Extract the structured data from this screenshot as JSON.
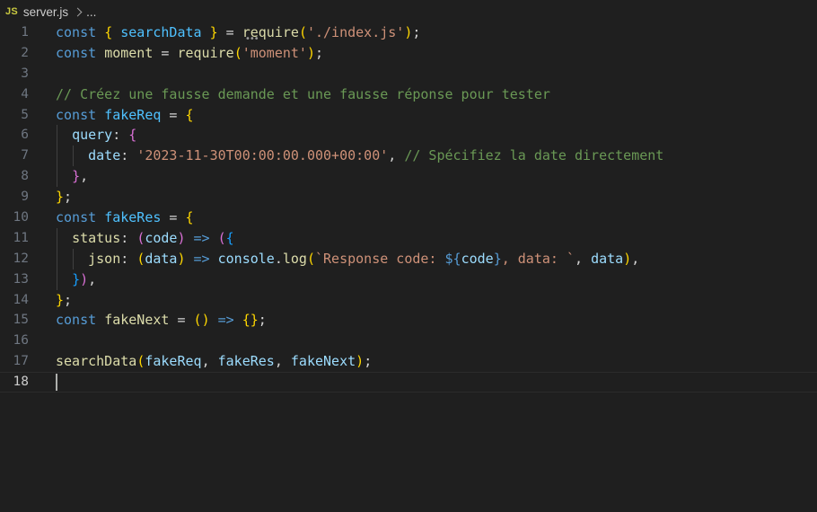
{
  "breadcrumb": {
    "file_icon": "JS",
    "file_name": "server.js",
    "separator_icon": "chevron-right-icon",
    "more": "..."
  },
  "colors": {
    "background": "#1f1f1f",
    "keyword": "#569cd6",
    "variable": "#9cdcfe",
    "constant": "#4fc1ff",
    "function": "#dcdcaa",
    "string": "#ce9178",
    "comment": "#6a9955",
    "punctuation": "#d4d4d4",
    "bracket_level1": "#ffd700",
    "bracket_level2": "#da70d6",
    "bracket_level3": "#179fff"
  },
  "editor": {
    "active_line": 18,
    "lines": [
      {
        "n": "1",
        "tokens": [
          {
            "t": "const",
            "c": "kw"
          },
          {
            "t": " ",
            "c": "p"
          },
          {
            "t": "{",
            "c": "b1"
          },
          {
            "t": " ",
            "c": "p"
          },
          {
            "t": "searchData",
            "c": "const"
          },
          {
            "t": " ",
            "c": "p"
          },
          {
            "t": "}",
            "c": "b1"
          },
          {
            "t": " = ",
            "c": "p"
          },
          {
            "t": "require",
            "c": "fn"
          },
          {
            "t": "(",
            "c": "b1"
          },
          {
            "t": "'./index.js'",
            "c": "str"
          },
          {
            "t": ")",
            "c": "b1"
          },
          {
            "t": ";",
            "c": "p"
          }
        ]
      },
      {
        "n": "2",
        "tokens": [
          {
            "t": "const",
            "c": "kw"
          },
          {
            "t": " ",
            "c": "p"
          },
          {
            "t": "moment",
            "c": "fn"
          },
          {
            "t": " = ",
            "c": "p"
          },
          {
            "t": "require",
            "c": "fn"
          },
          {
            "t": "(",
            "c": "b1"
          },
          {
            "t": "'moment'",
            "c": "str"
          },
          {
            "t": ")",
            "c": "b1"
          },
          {
            "t": ";",
            "c": "p"
          }
        ]
      },
      {
        "n": "3",
        "tokens": []
      },
      {
        "n": "4",
        "tokens": [
          {
            "t": "// Créez une fausse demande et une fausse réponse pour tester",
            "c": "cm"
          }
        ]
      },
      {
        "n": "5",
        "tokens": [
          {
            "t": "const",
            "c": "kw"
          },
          {
            "t": " ",
            "c": "p"
          },
          {
            "t": "fakeReq",
            "c": "const"
          },
          {
            "t": " = ",
            "c": "p"
          },
          {
            "t": "{",
            "c": "b1"
          }
        ]
      },
      {
        "n": "6",
        "guides": [
          1
        ],
        "tokens": [
          {
            "t": "  ",
            "c": "p"
          },
          {
            "t": "query",
            "c": "var"
          },
          {
            "t": ": ",
            "c": "p"
          },
          {
            "t": "{",
            "c": "b2"
          }
        ]
      },
      {
        "n": "7",
        "guides": [
          1,
          2
        ],
        "tokens": [
          {
            "t": "    ",
            "c": "p"
          },
          {
            "t": "date",
            "c": "var"
          },
          {
            "t": ": ",
            "c": "p"
          },
          {
            "t": "'2023-11-30T00:00:00.000+00:00'",
            "c": "str"
          },
          {
            "t": ", ",
            "c": "p"
          },
          {
            "t": "// Spécifiez la date directement",
            "c": "cm"
          }
        ]
      },
      {
        "n": "8",
        "guides": [
          1
        ],
        "tokens": [
          {
            "t": "  ",
            "c": "p"
          },
          {
            "t": "}",
            "c": "b2"
          },
          {
            "t": ",",
            "c": "p"
          }
        ]
      },
      {
        "n": "9",
        "tokens": [
          {
            "t": "}",
            "c": "b1"
          },
          {
            "t": ";",
            "c": "p"
          }
        ]
      },
      {
        "n": "10",
        "tokens": [
          {
            "t": "const",
            "c": "kw"
          },
          {
            "t": " ",
            "c": "p"
          },
          {
            "t": "fakeRes",
            "c": "const"
          },
          {
            "t": " = ",
            "c": "p"
          },
          {
            "t": "{",
            "c": "b1"
          }
        ]
      },
      {
        "n": "11",
        "guides": [
          1
        ],
        "tokens": [
          {
            "t": "  ",
            "c": "p"
          },
          {
            "t": "status",
            "c": "fn"
          },
          {
            "t": ": ",
            "c": "p"
          },
          {
            "t": "(",
            "c": "b2"
          },
          {
            "t": "code",
            "c": "var"
          },
          {
            "t": ")",
            "c": "b2"
          },
          {
            "t": " ",
            "c": "p"
          },
          {
            "t": "=>",
            "c": "kw"
          },
          {
            "t": " ",
            "c": "p"
          },
          {
            "t": "(",
            "c": "b2"
          },
          {
            "t": "{",
            "c": "b3"
          }
        ]
      },
      {
        "n": "12",
        "guides": [
          1,
          2
        ],
        "tokens": [
          {
            "t": "    ",
            "c": "p"
          },
          {
            "t": "json",
            "c": "fn"
          },
          {
            "t": ": ",
            "c": "p"
          },
          {
            "t": "(",
            "c": "b1"
          },
          {
            "t": "data",
            "c": "var"
          },
          {
            "t": ")",
            "c": "b1"
          },
          {
            "t": " ",
            "c": "p"
          },
          {
            "t": "=>",
            "c": "kw"
          },
          {
            "t": " ",
            "c": "p"
          },
          {
            "t": "console",
            "c": "var"
          },
          {
            "t": ".",
            "c": "p"
          },
          {
            "t": "log",
            "c": "fn"
          },
          {
            "t": "(",
            "c": "b1"
          },
          {
            "t": "`Response code: ",
            "c": "str"
          },
          {
            "t": "${",
            "c": "kw"
          },
          {
            "t": "code",
            "c": "var"
          },
          {
            "t": "}",
            "c": "kw"
          },
          {
            "t": ", data: `",
            "c": "str"
          },
          {
            "t": ", ",
            "c": "p"
          },
          {
            "t": "data",
            "c": "var"
          },
          {
            "t": ")",
            "c": "b1"
          },
          {
            "t": ",",
            "c": "p"
          }
        ]
      },
      {
        "n": "13",
        "guides": [
          1
        ],
        "tokens": [
          {
            "t": "  ",
            "c": "p"
          },
          {
            "t": "}",
            "c": "b3"
          },
          {
            "t": ")",
            "c": "b2"
          },
          {
            "t": ",",
            "c": "p"
          }
        ]
      },
      {
        "n": "14",
        "tokens": [
          {
            "t": "}",
            "c": "b1"
          },
          {
            "t": ";",
            "c": "p"
          }
        ]
      },
      {
        "n": "15",
        "tokens": [
          {
            "t": "const",
            "c": "kw"
          },
          {
            "t": " ",
            "c": "p"
          },
          {
            "t": "fakeNext",
            "c": "fn"
          },
          {
            "t": " = ",
            "c": "p"
          },
          {
            "t": "(",
            "c": "b1"
          },
          {
            "t": ")",
            "c": "b1"
          },
          {
            "t": " ",
            "c": "p"
          },
          {
            "t": "=>",
            "c": "kw"
          },
          {
            "t": " ",
            "c": "p"
          },
          {
            "t": "{",
            "c": "b1"
          },
          {
            "t": "}",
            "c": "b1"
          },
          {
            "t": ";",
            "c": "p"
          }
        ]
      },
      {
        "n": "16",
        "tokens": []
      },
      {
        "n": "17",
        "tokens": [
          {
            "t": "searchData",
            "c": "fn"
          },
          {
            "t": "(",
            "c": "b1"
          },
          {
            "t": "fakeReq",
            "c": "var"
          },
          {
            "t": ", ",
            "c": "p"
          },
          {
            "t": "fakeRes",
            "c": "var"
          },
          {
            "t": ", ",
            "c": "p"
          },
          {
            "t": "fakeNext",
            "c": "var"
          },
          {
            "t": ")",
            "c": "b1"
          },
          {
            "t": ";",
            "c": "p"
          }
        ]
      },
      {
        "n": "18",
        "tokens": []
      }
    ]
  }
}
